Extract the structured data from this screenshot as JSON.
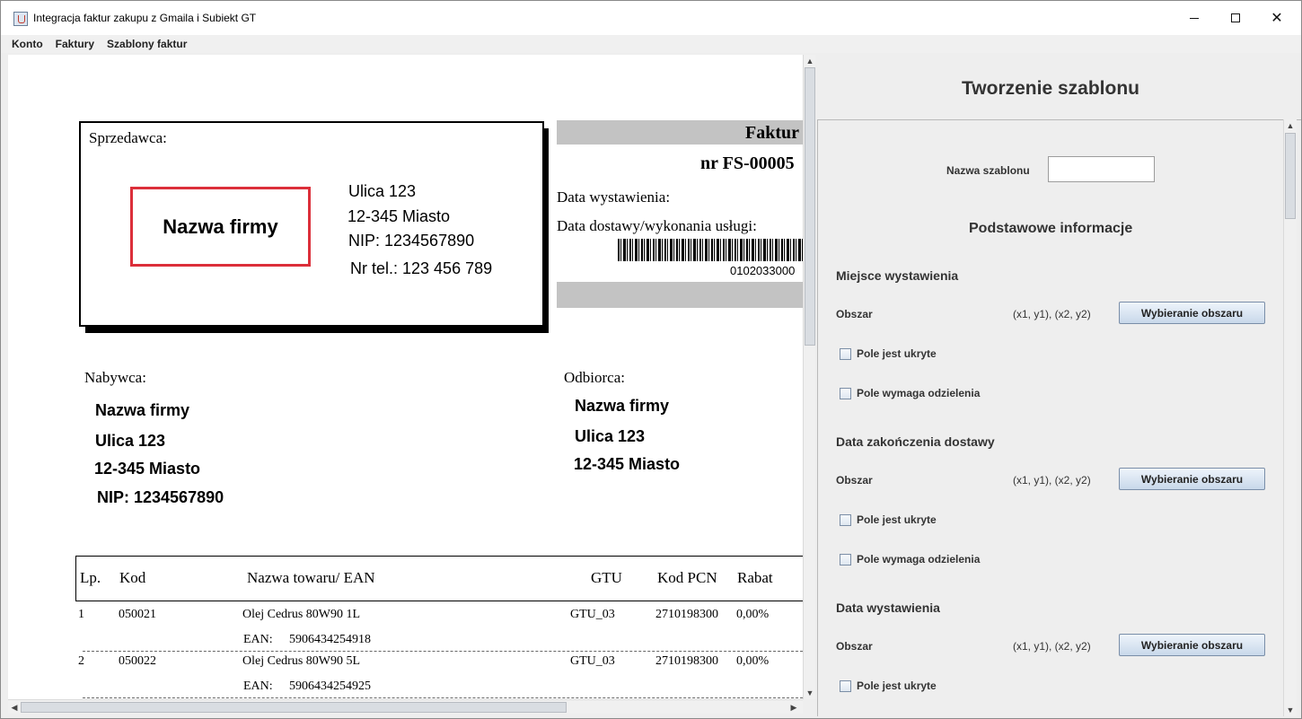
{
  "window": {
    "title": "Integracja faktur zakupu z Gmaila i Subiekt GT",
    "close_glyph": "✕"
  },
  "menu": [
    "Konto",
    "Faktury",
    "Szablony faktur"
  ],
  "invoice": {
    "seller": {
      "label": "Sprzedawca:",
      "name": "Nazwa firmy",
      "lines": [
        "Ulica 123",
        "12-345 Miasto",
        "NIP: 1234567890",
        "Nr tel.: 123 456 789"
      ]
    },
    "header": {
      "title": "Faktur",
      "number": "nr FS-00005",
      "issue_date_label": "Data wystawienia:",
      "delivery_date_label": "Data dostawy/wykonania usługi:",
      "barcode_number": "0102033000"
    },
    "buyer": {
      "label": "Nabywca:",
      "lines": [
        "Nazwa firmy",
        "Ulica 123",
        "12-345 Miasto",
        "NIP: 1234567890"
      ]
    },
    "recipient": {
      "label": "Odbiorca:",
      "lines": [
        "Nazwa firmy",
        "Ulica 123",
        "12-345 Miasto"
      ]
    },
    "table": {
      "columns": [
        "Lp.",
        "Kod",
        "Nazwa towaru/ EAN",
        "GTU",
        "Kod PCN",
        "Rabat"
      ],
      "rows": [
        {
          "lp": "1",
          "kod": "050021",
          "name": "Olej Cedrus 80W90 1L",
          "ean_label": "EAN:",
          "ean": "5906434254918",
          "gtu": "GTU_03",
          "pcn": "2710198300",
          "rabat": "0,00%"
        },
        {
          "lp": "2",
          "kod": "050022",
          "name": "Olej Cedrus 80W90 5L",
          "ean_label": "EAN:",
          "ean": "5906434254925",
          "gtu": "GTU_03",
          "pcn": "2710198300",
          "rabat": "0,00%"
        }
      ]
    }
  },
  "template": {
    "title": "Tworzenie szablonu",
    "name_label": "Nazwa szablonu",
    "name_value": "",
    "basic_info": "Podstawowe informacje",
    "sections": [
      {
        "title": "Miejsce wystawienia",
        "area_label": "Obszar",
        "coords": "(x1, y1), (x2, y2)",
        "button": "Wybieranie obszaru",
        "hidden_label": "Pole jest ukryte",
        "separate_label": "Pole wymaga odzielenia"
      },
      {
        "title": "Data zakończenia dostawy",
        "area_label": "Obszar",
        "coords": "(x1, y1), (x2, y2)",
        "button": "Wybieranie obszaru",
        "hidden_label": "Pole jest ukryte",
        "separate_label": "Pole wymaga odzielenia"
      },
      {
        "title": "Data wystawienia",
        "area_label": "Obszar",
        "coords": "(x1, y1), (x2, y2)",
        "button": "Wybieranie obszaru",
        "hidden_label": "Pole jest ukryte"
      }
    ]
  },
  "scroll": {
    "up": "▲",
    "down": "▼",
    "left": "◀",
    "right": "▶"
  }
}
